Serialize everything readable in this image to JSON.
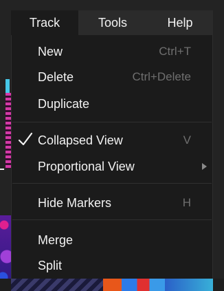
{
  "menubar": {
    "items": [
      {
        "label": "Track"
      },
      {
        "label": "Tools"
      },
      {
        "label": "Help"
      }
    ],
    "active": "Track"
  },
  "track_menu": {
    "items": [
      {
        "label": "New",
        "shortcut": "Ctrl+T"
      },
      {
        "label": "Delete",
        "shortcut": "Ctrl+Delete"
      },
      {
        "label": "Duplicate",
        "shortcut": ""
      },
      {
        "label": "Collapsed View",
        "shortcut": "V",
        "checked": true
      },
      {
        "label": "Proportional View",
        "shortcut": "",
        "submenu": true
      },
      {
        "label": "Hide Markers",
        "shortcut": "H"
      },
      {
        "label": "Merge",
        "shortcut": ""
      },
      {
        "label": "Split",
        "shortcut": ""
      }
    ]
  },
  "icons": {
    "check": "checkmark-icon",
    "submenu": "submenu-arrow-icon"
  },
  "colors": {
    "menu_bg": "#1b1b1b",
    "menubar_bg": "#2b2b2b",
    "text": "#f2f2f2",
    "shortcut_text": "#6f6f6f",
    "separator": "#303030"
  }
}
